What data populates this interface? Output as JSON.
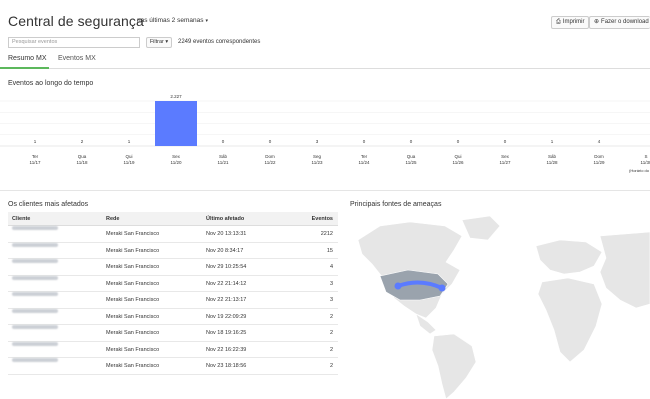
{
  "header": {
    "title": "Central de segurança",
    "range": "nas últimas 2 semanas",
    "print": "Imprimir",
    "download": "Fazer o download"
  },
  "search": {
    "placeholder": "Pesquisar eventos",
    "filter": "Filtrar",
    "count": "2249 eventos correspondentes"
  },
  "tabs": [
    {
      "label": "Resumo MX",
      "active": true
    },
    {
      "label": "Eventos MX",
      "active": false
    }
  ],
  "chart_title": "Eventos ao longo do tempo",
  "chart_data": {
    "type": "bar",
    "categories": [
      "Ter 11/17",
      "Qua 11/18",
      "Qui 11/19",
      "Sex 11/20",
      "Sáb 11/21",
      "Dom 11/22",
      "Seg 11/23",
      "Ter 11/24",
      "Qua 11/25",
      "Qui 11/26",
      "Sex 11/27",
      "Sáb 11/28",
      "Dom 11/29",
      "Seg 11/30"
    ],
    "day_labels": [
      "Ter",
      "Qua",
      "Qui",
      "Sex",
      "Sáb",
      "Dom",
      "Seg",
      "Ter",
      "Qua",
      "Qui",
      "Sex",
      "Sáb",
      "Dom",
      "S"
    ],
    "date_labels": [
      "11/17",
      "11/18",
      "11/19",
      "11/20",
      "11/21",
      "11/22",
      "11/23",
      "11/24",
      "11/25",
      "11/26",
      "11/27",
      "11/28",
      "11/29",
      "11/30"
    ],
    "values": [
      1,
      2,
      1,
      2227,
      0,
      0,
      3,
      0,
      0,
      0,
      0,
      1,
      4,
      0
    ],
    "value_labels": [
      "1",
      "2",
      "1",
      "2.227",
      "0",
      "0",
      "3",
      "0",
      "0",
      "0",
      "0",
      "1",
      "4",
      ""
    ],
    "footnote": "(Horário do",
    "color": "#5b7bff",
    "grid": true
  },
  "clients": {
    "title": "Os clientes mais afetados",
    "columns": [
      "Cliente",
      "Rede",
      "Último afetado",
      "Eventos"
    ],
    "rows": [
      {
        "rede": "Meraki San Francisco",
        "ultimo": "Nov 20 13:13:31",
        "eventos": "2212"
      },
      {
        "rede": "Meraki San Francisco",
        "ultimo": "Nov 20 8:34:17",
        "eventos": "15"
      },
      {
        "rede": "Meraki San Francisco",
        "ultimo": "Nov 29 10:25:54",
        "eventos": "4"
      },
      {
        "rede": "Meraki San Francisco",
        "ultimo": "Nov 22 21:14:12",
        "eventos": "3"
      },
      {
        "rede": "Meraki San Francisco",
        "ultimo": "Nov 22 21:13:17",
        "eventos": "3"
      },
      {
        "rede": "Meraki San Francisco",
        "ultimo": "Nov 19 22:09:29",
        "eventos": "2"
      },
      {
        "rede": "Meraki San Francisco",
        "ultimo": "Nov 18 19:16:25",
        "eventos": "2"
      },
      {
        "rede": "Meraki San Francisco",
        "ultimo": "Nov 22 16:22:39",
        "eventos": "2"
      },
      {
        "rede": "Meraki San Francisco",
        "ultimo": "Nov 23 18:18:56",
        "eventos": "2"
      }
    ]
  },
  "map_title": "Principais fontes de ameaças",
  "colors": {
    "accent": "#5b7bff",
    "tab_active": "#5cb85c",
    "land": "#e6e6e6",
    "ocean": "#ffffff",
    "highlight": "#9aa3ad"
  }
}
